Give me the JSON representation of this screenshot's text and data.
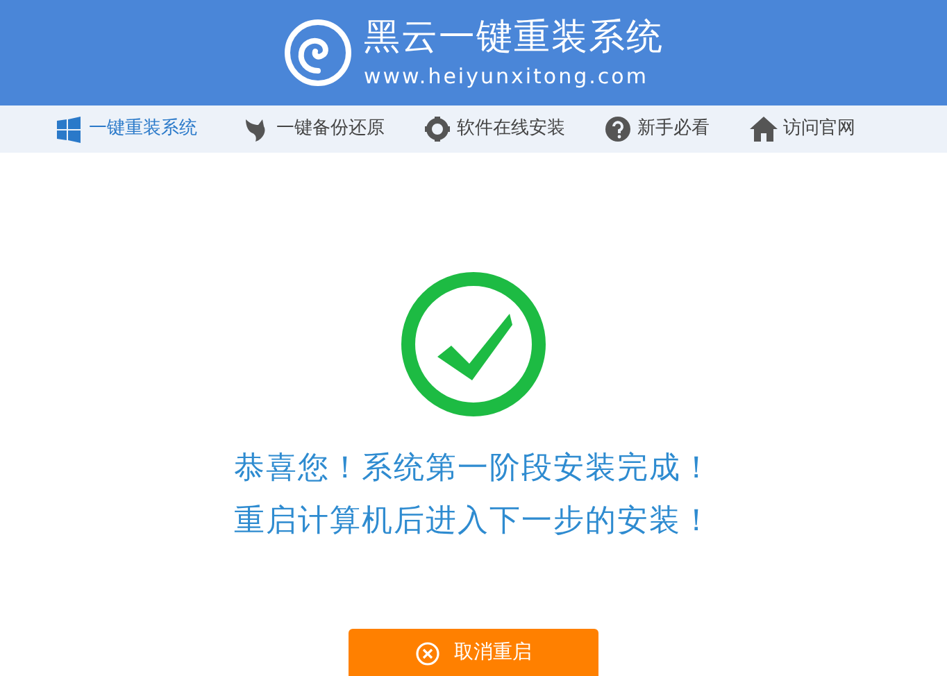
{
  "header": {
    "title": "黑云一键重装系统",
    "url": "www.heiyunxitong.com"
  },
  "nav": [
    {
      "label": "一键重装系统",
      "kind": "windows",
      "selected": true
    },
    {
      "label": "一键备份还原",
      "kind": "bird",
      "selected": false
    },
    {
      "label": "软件在线安装",
      "kind": "gear",
      "selected": false
    },
    {
      "label": "新手必看",
      "kind": "help",
      "selected": false
    },
    {
      "label": "访问官网",
      "kind": "home",
      "selected": false
    }
  ],
  "messages": [
    "恭喜您！系统第一阶段安装完成！",
    "重启计算机后进入下一步的安装！"
  ],
  "button": {
    "label": "取消重启"
  }
}
